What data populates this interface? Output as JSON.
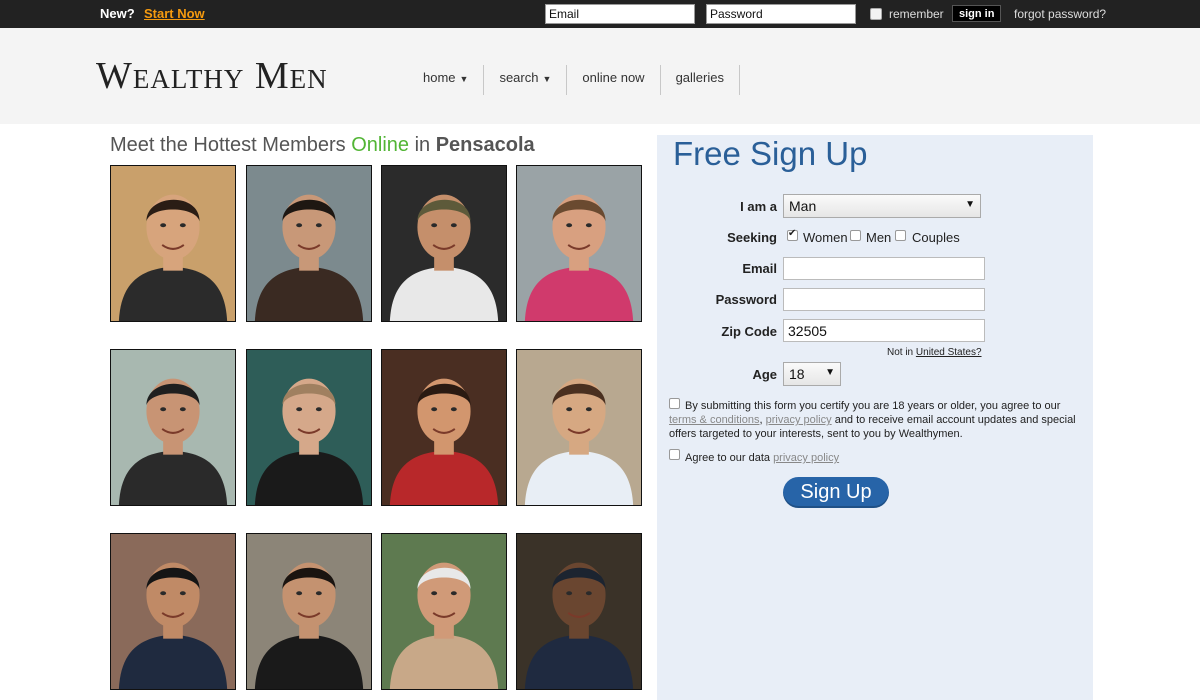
{
  "topbar": {
    "new_label": "New?",
    "start_now": "Start Now",
    "email_placeholder": "Email",
    "password_placeholder": "Password",
    "remember_label": "remember",
    "signin_label": "sign in",
    "forgot_label": "forgot password?"
  },
  "header": {
    "logo": "Wealthy Men",
    "nav": [
      {
        "label": "home",
        "caret": "▼"
      },
      {
        "label": "search",
        "caret": "▼"
      },
      {
        "label": "online now"
      },
      {
        "label": "galleries"
      }
    ]
  },
  "members": {
    "title_prefix": "Meet the Hottest Members ",
    "title_online": "Online",
    "title_in": " in ",
    "title_city": "Pensacola",
    "photos": [
      {
        "bg": "#c9a06b",
        "skin": "#d7a47c",
        "hair": "#2a1d15",
        "shirt": "#2b2b2b"
      },
      {
        "bg": "#7c8a8e",
        "skin": "#c89878",
        "hair": "#1e1712",
        "shirt": "#3a2a22"
      },
      {
        "bg": "#2b2b2b",
        "skin": "#c58f6b",
        "hair": "#5d5a3a",
        "shirt": "#e8e8e8"
      },
      {
        "bg": "#9aa3a6",
        "skin": "#d8a080",
        "hair": "#6a4a30",
        "shirt": "#d03a6c"
      },
      {
        "bg": "#a8b8b0",
        "skin": "#c89474",
        "hair": "#1f1f1f",
        "shirt": "#2a2a2a"
      },
      {
        "bg": "#2e5d58",
        "skin": "#d5a88a",
        "hair": "#a08060",
        "shirt": "#1a1a1a"
      },
      {
        "bg": "#4a2e22",
        "skin": "#d2966e",
        "hair": "#2a1a12",
        "shirt": "#b8282a"
      },
      {
        "bg": "#b8a890",
        "skin": "#d6a882",
        "hair": "#4a3020",
        "shirt": "#e8eef5"
      },
      {
        "bg": "#8a6a5a",
        "skin": "#c08a66",
        "hair": "#151515",
        "shirt": "#1f2a3f"
      },
      {
        "bg": "#8c8578",
        "skin": "#c49270",
        "hair": "#1a1410",
        "shirt": "#1a1a1a"
      },
      {
        "bg": "#5e7a50",
        "skin": "#d09a78",
        "hair": "#e8e8e8",
        "shirt": "#c8a888"
      },
      {
        "bg": "#3a3228",
        "skin": "#6a4630",
        "hair": "#1c2430",
        "shirt": "#1f2a40"
      }
    ]
  },
  "signup": {
    "title": "Free Sign Up",
    "iama_label": "I am a",
    "iama_value": "Man",
    "seeking_label": "Seeking",
    "seeking_options": [
      {
        "label": "Women",
        "checked": true
      },
      {
        "label": "Men",
        "checked": false
      },
      {
        "label": "Couples",
        "checked": false
      }
    ],
    "email_label": "Email",
    "password_label": "Password",
    "zip_label": "Zip Code",
    "zip_value": "32505",
    "not_in_prefix": "Not in ",
    "not_in_country": "United States?",
    "age_label": "Age",
    "age_value": "18",
    "terms_part1": "By submitting this form you certify you are 18 years or older, you agree to our ",
    "terms_link1": "terms & conditions",
    "terms_sep": ", ",
    "terms_link2": "privacy policy",
    "terms_part2": " and to receive email account updates and special offers targeted to your interests, sent to you by Wealthymen.",
    "agree_prefix": "Agree to our data ",
    "agree_link": "privacy policy",
    "button_label": "Sign Up"
  }
}
